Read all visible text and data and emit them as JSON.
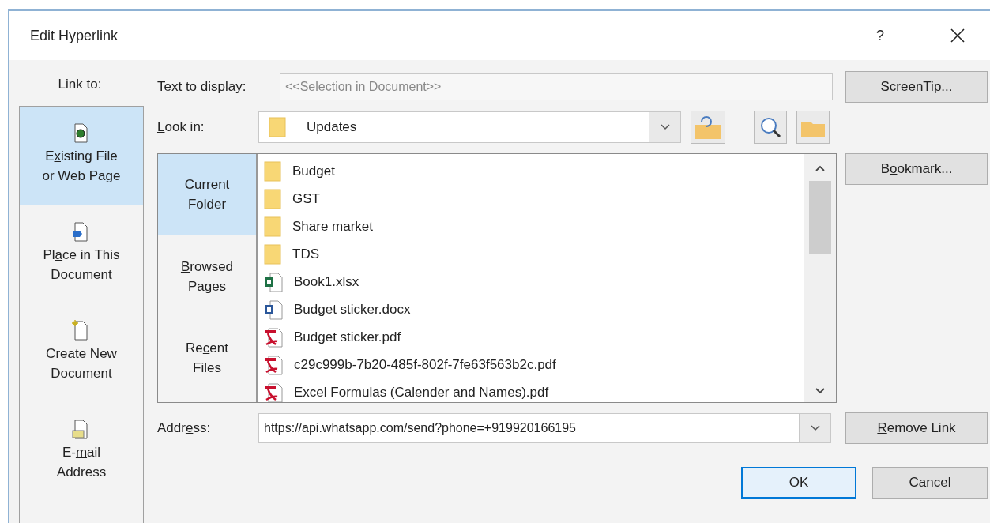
{
  "window": {
    "title": "Edit Hyperlink",
    "help": "?"
  },
  "link_to": {
    "label": "Link to:",
    "items": [
      {
        "label": {
          "pre": "E",
          "key": "x",
          "post": "isting File\nor Web Page"
        },
        "kind": "file",
        "selected": true
      },
      {
        "label": {
          "pre": "Pl",
          "key": "a",
          "post": "ce in This\nDocument"
        },
        "kind": "place",
        "selected": false
      },
      {
        "label": {
          "pre": "Create ",
          "key": "N",
          "post": "ew\nDocument"
        },
        "kind": "new",
        "selected": false
      },
      {
        "label": {
          "pre": "E-",
          "key": "m",
          "post": "ail\nAddress"
        },
        "kind": "email",
        "selected": false
      }
    ]
  },
  "text_to_display": {
    "label": {
      "key": "T",
      "post": "ext to display:"
    },
    "value": "<<Selection in Document>>",
    "disabled": true
  },
  "look_in": {
    "label": {
      "key": "L",
      "post": "ook in:"
    },
    "value": "Updates"
  },
  "nav": [
    {
      "label": {
        "pre": "C",
        "key": "u",
        "post": "rrent\nFolder"
      },
      "selected": true
    },
    {
      "label": {
        "key": "B",
        "post": "rowsed\nPages"
      },
      "selected": false
    },
    {
      "label": {
        "pre": "Re",
        "key": "c",
        "post": "ent\nFiles"
      },
      "selected": false
    }
  ],
  "files": [
    {
      "name": "Budget",
      "kind": "folder"
    },
    {
      "name": "GST",
      "kind": "folder"
    },
    {
      "name": "Share market",
      "kind": "folder"
    },
    {
      "name": "TDS",
      "kind": "folder"
    },
    {
      "name": "Book1.xlsx",
      "kind": "excel"
    },
    {
      "name": "Budget sticker.docx",
      "kind": "word"
    },
    {
      "name": "Budget sticker.pdf",
      "kind": "pdf"
    },
    {
      "name": "c29c999b-7b20-485f-802f-7fe63f563b2c.pdf",
      "kind": "pdf"
    },
    {
      "name": "Excel Formulas (Calender and Names).pdf",
      "kind": "pdf"
    }
  ],
  "address": {
    "label": {
      "pre": "Addr",
      "key": "e",
      "post": "ss:"
    },
    "value": "https://api.whatsapp.com/send?phone=+919920166195"
  },
  "side_buttons": [
    {
      "label": {
        "pre": "ScreenTi",
        "key": "p",
        "post": "..."
      }
    },
    {
      "label": {
        "pre": "B",
        "key": "o",
        "post": "okmark..."
      }
    },
    {
      "label": {
        "key": "R",
        "post": "emove Link"
      }
    }
  ],
  "footer_buttons": [
    {
      "label": {
        "pre": "OK"
      },
      "default": true
    },
    {
      "label": {
        "pre": "Cancel"
      },
      "default": false
    }
  ]
}
